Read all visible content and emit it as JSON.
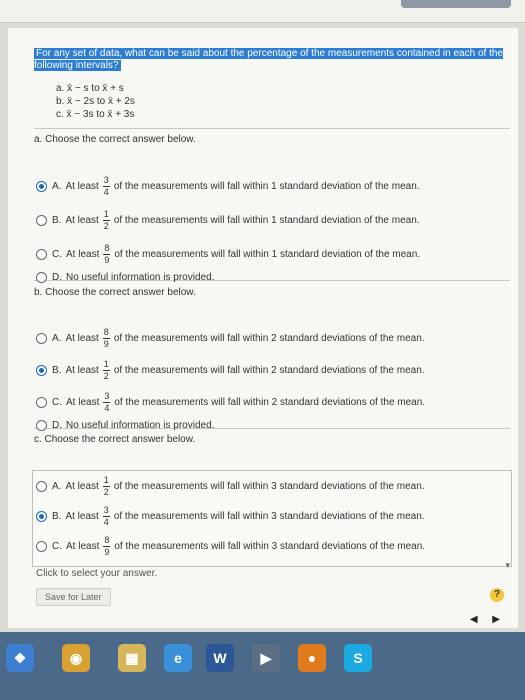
{
  "question": "For any set of data, what can be said about the percentage of the measurements contained in each of the following intervals?",
  "intervals": [
    "a. x̄ − s to x̄ + s",
    "b. x̄ − 2s to x̄ + 2s",
    "c. x̄ − 3s to x̄ + 3s"
  ],
  "parts": [
    {
      "prompt": "a. Choose the correct answer below.",
      "options": [
        {
          "label": "A.",
          "lead": "At least",
          "num": "3",
          "den": "4",
          "text": "of the measurements will fall within 1 standard deviation of the mean.",
          "selected": true
        },
        {
          "label": "B.",
          "lead": "At least",
          "num": "1",
          "den": "2",
          "text": "of the measurements will fall within 1 standard deviation of the mean.",
          "selected": false
        },
        {
          "label": "C.",
          "lead": "At least",
          "num": "8",
          "den": "9",
          "text": "of the measurements will fall within 1 standard deviation of the mean.",
          "selected": false
        },
        {
          "label": "D.",
          "lead": "No useful information is provided.",
          "num": "",
          "den": "",
          "text": "",
          "selected": false
        }
      ]
    },
    {
      "prompt": "b. Choose the correct answer below.",
      "options": [
        {
          "label": "A.",
          "lead": "At least",
          "num": "8",
          "den": "9",
          "text": "of the measurements will fall within 2 standard deviations of the mean.",
          "selected": false
        },
        {
          "label": "B.",
          "lead": "At least",
          "num": "1",
          "den": "2",
          "text": "of the measurements will fall within 2 standard deviations of the mean.",
          "selected": true
        },
        {
          "label": "C.",
          "lead": "At least",
          "num": "3",
          "den": "4",
          "text": "of the measurements will fall within 2 standard deviations of the mean.",
          "selected": false
        },
        {
          "label": "D.",
          "lead": "No useful information is provided.",
          "num": "",
          "den": "",
          "text": "",
          "selected": false
        }
      ]
    },
    {
      "prompt": "c. Choose the correct answer below.",
      "options": [
        {
          "label": "A.",
          "lead": "At least",
          "num": "1",
          "den": "2",
          "text": "of the measurements will fall within 3 standard deviations of the mean.",
          "selected": false
        },
        {
          "label": "B.",
          "lead": "At least",
          "num": "3",
          "den": "4",
          "text": "of the measurements will fall within 3 standard deviations of the mean.",
          "selected": true
        },
        {
          "label": "C.",
          "lead": "At least",
          "num": "8",
          "den": "9",
          "text": "of the measurements will fall within 3 standard deviations of the mean.",
          "selected": false
        }
      ]
    }
  ],
  "status": "Click to select your answer.",
  "save_label": "Save for Later",
  "help_label": "?",
  "nav": {
    "prev": "◀",
    "next": "▶"
  },
  "taskbar": [
    {
      "name": "start-icon",
      "glyph": "❖",
      "color": "#3c7fd0"
    },
    {
      "name": "chrome-icon",
      "glyph": "◉",
      "color": "#d8a132"
    },
    {
      "name": "file-explorer-icon",
      "glyph": "▦",
      "color": "#d7b55a"
    },
    {
      "name": "internet-explorer-icon",
      "glyph": "e",
      "color": "#3a8fd9"
    },
    {
      "name": "word-icon",
      "glyph": "W",
      "color": "#2b5797"
    },
    {
      "name": "media-player-icon",
      "glyph": "▶",
      "color": "#5a6f83"
    },
    {
      "name": "media-icon",
      "glyph": "●",
      "color": "#e27a1e"
    },
    {
      "name": "skype-icon",
      "glyph": "S",
      "color": "#1ba9e1"
    }
  ]
}
